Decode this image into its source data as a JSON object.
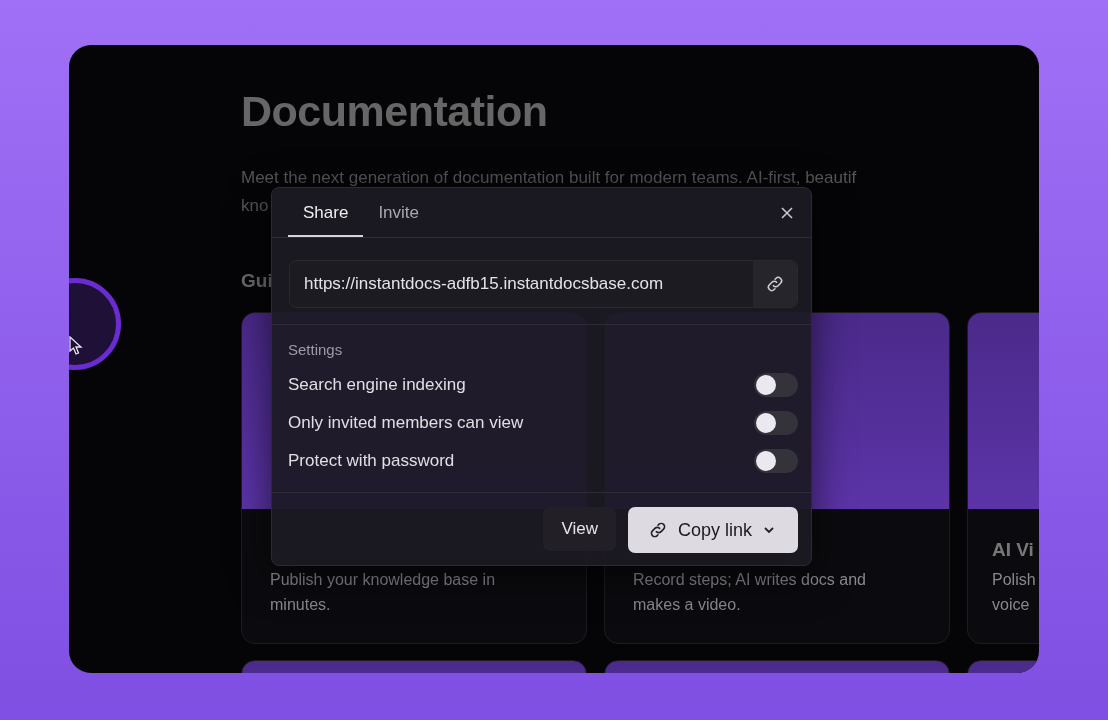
{
  "page": {
    "title": "Documentation",
    "description": "Meet the next generation of documentation built for modern teams. AI-first, beautif",
    "description_line_2": "kno",
    "section_heading": "Gui"
  },
  "cards": [
    {
      "lines": [
        "Publish your knowledge base in",
        "minutes."
      ]
    },
    {
      "lines": [
        "Record steps; AI writes docs and",
        "makes a video."
      ]
    },
    {
      "title": "AI Vi",
      "lines": [
        "Polish",
        "voice"
      ]
    }
  ],
  "dialog": {
    "tabs": [
      {
        "label": "Share",
        "selected": true
      },
      {
        "label": "Invite",
        "selected": false
      }
    ],
    "url": "https://instantdocs-adfb15.instantdocsbase.com",
    "settings_label": "Settings",
    "settings": [
      {
        "label": "Search engine indexing",
        "on": false
      },
      {
        "label": "Only invited members can view",
        "on": false
      },
      {
        "label": "Protect with password",
        "on": false
      }
    ],
    "view_button": "View",
    "copy_button": "Copy link"
  }
}
